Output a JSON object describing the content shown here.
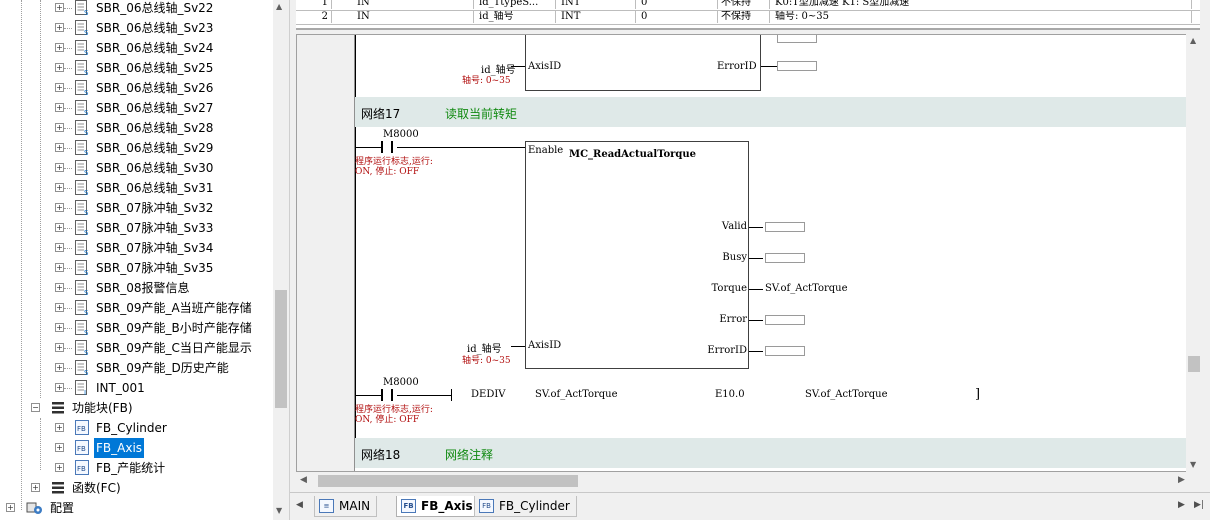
{
  "tree": {
    "sbr_items": [
      "SBR_06总线轴_Sv22",
      "SBR_06总线轴_Sv23",
      "SBR_06总线轴_Sv24",
      "SBR_06总线轴_Sv25",
      "SBR_06总线轴_Sv26",
      "SBR_06总线轴_Sv27",
      "SBR_06总线轴_Sv28",
      "SBR_06总线轴_Sv29",
      "SBR_06总线轴_Sv30",
      "SBR_06总线轴_Sv31",
      "SBR_07脉冲轴_Sv32",
      "SBR_07脉冲轴_Sv33",
      "SBR_07脉冲轴_Sv34",
      "SBR_07脉冲轴_Sv35",
      "SBR_08报警信息",
      "SBR_09产能_A当班产能存储",
      "SBR_09产能_B小时产能存储",
      "SBR_09产能_C当日产能显示",
      "SBR_09产能_D历史产能"
    ],
    "int_item": "INT_001",
    "fb_group": "功能块(FB)",
    "fb_items": [
      "FB_Cylinder",
      "FB_Axis",
      "FB_产能统计"
    ],
    "fb_selected": "FB_Axis",
    "fc_group": "函数(FC)",
    "config_group": "配置"
  },
  "var_table": {
    "rows": [
      {
        "no": "1",
        "cls": "IN",
        "name": "id_TtypeS...",
        "type": "INT",
        "init": "0",
        "retain": "不保持",
        "comment": "K0:T型加减速 K1: S型加减速"
      },
      {
        "no": "2",
        "cls": "IN",
        "name": "id_轴号",
        "type": "INT",
        "init": "0",
        "retain": "不保持",
        "comment": "轴号: 0~35"
      }
    ]
  },
  "ladder": {
    "prev_block": {
      "input_var": "id_轴号",
      "input_comment": "轴号: 0~35",
      "pin_axis": "AxisID",
      "pin_error_partial": "Error",
      "pin_errorid": "ErrorID"
    },
    "network17": {
      "label": "网络17",
      "comment": "读取当前转矩"
    },
    "contact1": {
      "name": "M8000",
      "comment": "程序运行标志,运行: ON, 停止: OFF"
    },
    "fb": {
      "enable": "Enable",
      "title": "MC_ReadActualTorque",
      "outputs": [
        "Valid",
        "Busy",
        "Torque",
        "Error",
        "ErrorID"
      ],
      "torque_target": "SV.of_ActTorque",
      "input_pin": "AxisID",
      "input_var": "id_轴号",
      "input_comment": "轴号: 0~35"
    },
    "contact2": {
      "name": "M8000",
      "comment": "程序运行标志,运行: ON, 停止: OFF"
    },
    "dediv": {
      "op": "DEDIV",
      "arg1": "SV.of_ActTorque",
      "arg2": "E10.0",
      "arg3": "SV.of_ActTorque",
      "close": "]"
    },
    "network18": {
      "label": "网络18",
      "comment": "网络注释"
    }
  },
  "tabs": [
    {
      "label": "MAIN",
      "icon": "ladder-icon",
      "active": false
    },
    {
      "label": "FB_Axis",
      "icon": "fb-icon",
      "active": true
    },
    {
      "label": "FB_Cylinder",
      "icon": "fb-icon",
      "active": false
    }
  ],
  "icons": {
    "subroutine": "ladder-doc-icon",
    "fb": "fb-icon",
    "fb_group": "fb-group-icon",
    "fc_group": "fc-group-icon",
    "config": "config-icon"
  },
  "colors": {
    "selection": "#0078d7",
    "network_bg": "#dfe9e8",
    "network_comment": "#118a11",
    "contact_comment": "#b21010"
  }
}
